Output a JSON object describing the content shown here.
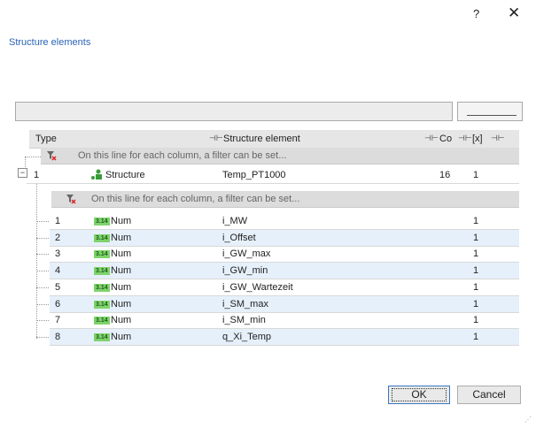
{
  "window": {
    "help_label": "?",
    "close_label": "✕"
  },
  "title": "Structure elements",
  "grid": {
    "columns": [
      "Type",
      "Structure element",
      "Co",
      "[x]"
    ],
    "filter_text": "On this line for each column, a filter can be set...",
    "parent": {
      "id": "1",
      "type": "Structure",
      "element": "Temp_PT1000",
      "co": "16",
      "x": "1"
    },
    "children": [
      {
        "id": "1",
        "badge": "3.14",
        "type": "Num",
        "element": "i_MW",
        "x": "1"
      },
      {
        "id": "2",
        "badge": "3.14",
        "type": "Num",
        "element": "i_Offset",
        "x": "1"
      },
      {
        "id": "3",
        "badge": "3.14",
        "type": "Num",
        "element": "i_GW_max",
        "x": "1"
      },
      {
        "id": "4",
        "badge": "3.14",
        "type": "Num",
        "element": "i_GW_min",
        "x": "1"
      },
      {
        "id": "5",
        "badge": "3.14",
        "type": "Num",
        "element": "i_GW_Wartezeit",
        "x": "1"
      },
      {
        "id": "6",
        "badge": "3.14",
        "type": "Num",
        "element": "i_SM_max",
        "x": "1"
      },
      {
        "id": "7",
        "badge": "3.14",
        "type": "Num",
        "element": "i_SM_min",
        "x": "1"
      },
      {
        "id": "8",
        "badge": "3.14",
        "type": "Num",
        "element": "q_Xi_Temp",
        "x": "1"
      }
    ]
  },
  "buttons": {
    "ok": "OK",
    "cancel": "Cancel"
  }
}
